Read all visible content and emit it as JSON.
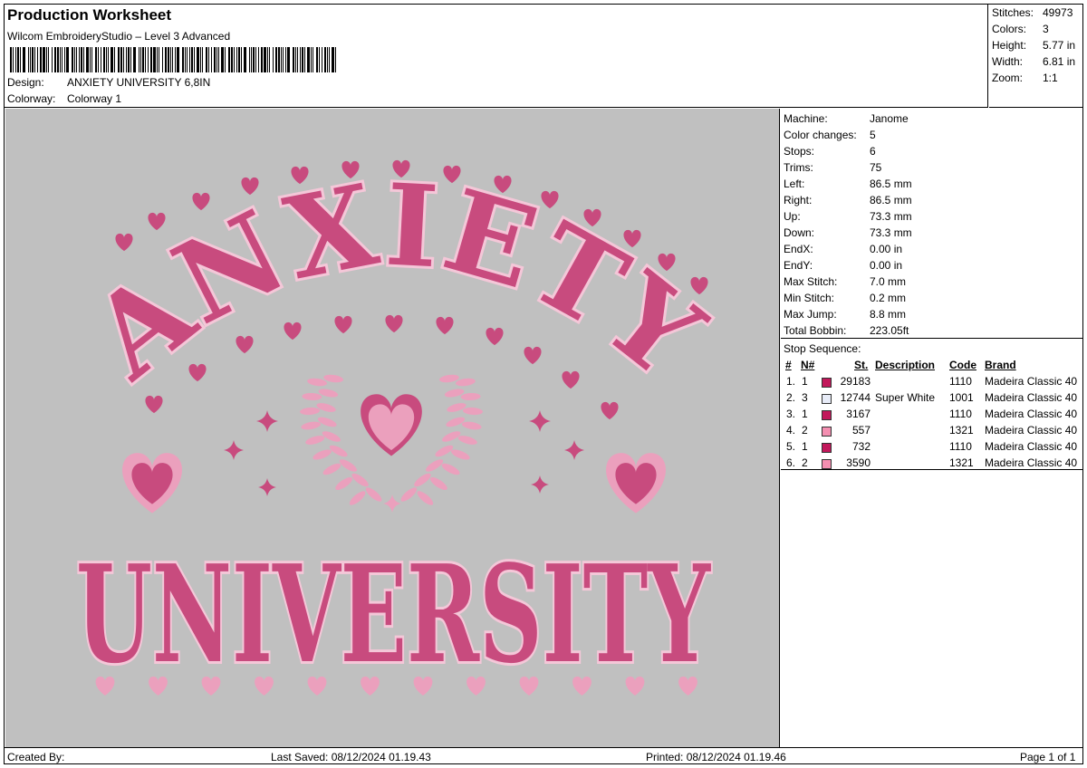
{
  "header": {
    "title": "Production Worksheet",
    "subtitle": "Wilcom EmbroideryStudio – Level 3 Advanced",
    "design_label": "Design:",
    "design_value": "ANXIETY UNIVERSITY 6,8IN",
    "colorway_label": "Colorway:",
    "colorway_value": "Colorway 1"
  },
  "summary": {
    "stitches_label": "Stitches:",
    "stitches": "49973",
    "colors_label": "Colors:",
    "colors": "3",
    "height_label": "Height:",
    "height": "5.77 in",
    "width_label": "Width:",
    "width": "6.81 in",
    "zoom_label": "Zoom:",
    "zoom": "1:1"
  },
  "design": {
    "top_text": "ANXIETY",
    "bottom_text": "UNIVERSITY",
    "fill_color": "#c84b7e",
    "outline_color": "#f4c7d8",
    "light_color": "#eba0bd",
    "background": "#c0c0c0"
  },
  "machine": [
    {
      "label": "Machine:",
      "value": "Janome"
    },
    {
      "label": "Color changes:",
      "value": "5"
    },
    {
      "label": "Stops:",
      "value": "6"
    },
    {
      "label": "Trims:",
      "value": "75"
    },
    {
      "label": "Left:",
      "value": "86.5 mm"
    },
    {
      "label": "Right:",
      "value": "86.5 mm"
    },
    {
      "label": "Up:",
      "value": "73.3 mm"
    },
    {
      "label": "Down:",
      "value": "73.3 mm"
    },
    {
      "label": "EndX:",
      "value": "0.00 in"
    },
    {
      "label": "EndY:",
      "value": "0.00 in"
    },
    {
      "label": "Max Stitch:",
      "value": "7.0 mm"
    },
    {
      "label": "Min Stitch:",
      "value": "0.2 mm"
    },
    {
      "label": "Max Jump:",
      "value": "8.8 mm"
    },
    {
      "label": "Total Bobbin:",
      "value": "223.05ft"
    }
  ],
  "stop_sequence": {
    "title": "Stop Sequence:",
    "headers": {
      "num": "#",
      "n": "N#",
      "st": "St.",
      "desc": "Description",
      "code": "Code",
      "brand": "Brand"
    },
    "rows": [
      {
        "num": "1.",
        "n": "1",
        "color": "#c2185b",
        "st": "29183",
        "desc": "",
        "code": "1110",
        "brand": "Madeira Classic 40"
      },
      {
        "num": "2.",
        "n": "3",
        "color": "#e8ecf8",
        "st": "12744",
        "desc": "Super White",
        "code": "1001",
        "brand": "Madeira Classic 40"
      },
      {
        "num": "3.",
        "n": "1",
        "color": "#c2185b",
        "st": "3167",
        "desc": "",
        "code": "1110",
        "brand": "Madeira Classic 40"
      },
      {
        "num": "4.",
        "n": "2",
        "color": "#f48fb1",
        "st": "557",
        "desc": "",
        "code": "1321",
        "brand": "Madeira Classic 40"
      },
      {
        "num": "5.",
        "n": "1",
        "color": "#c2185b",
        "st": "732",
        "desc": "",
        "code": "1110",
        "brand": "Madeira Classic 40"
      },
      {
        "num": "6.",
        "n": "2",
        "color": "#f48fb1",
        "st": "3590",
        "desc": "",
        "code": "1321",
        "brand": "Madeira Classic 40"
      }
    ]
  },
  "footer": {
    "created_by": "Created By:",
    "last_saved": "Last Saved: 08/12/2024 01.19.43",
    "printed": "Printed: 08/12/2024 01.19.46",
    "page": "Page 1 of 1"
  }
}
